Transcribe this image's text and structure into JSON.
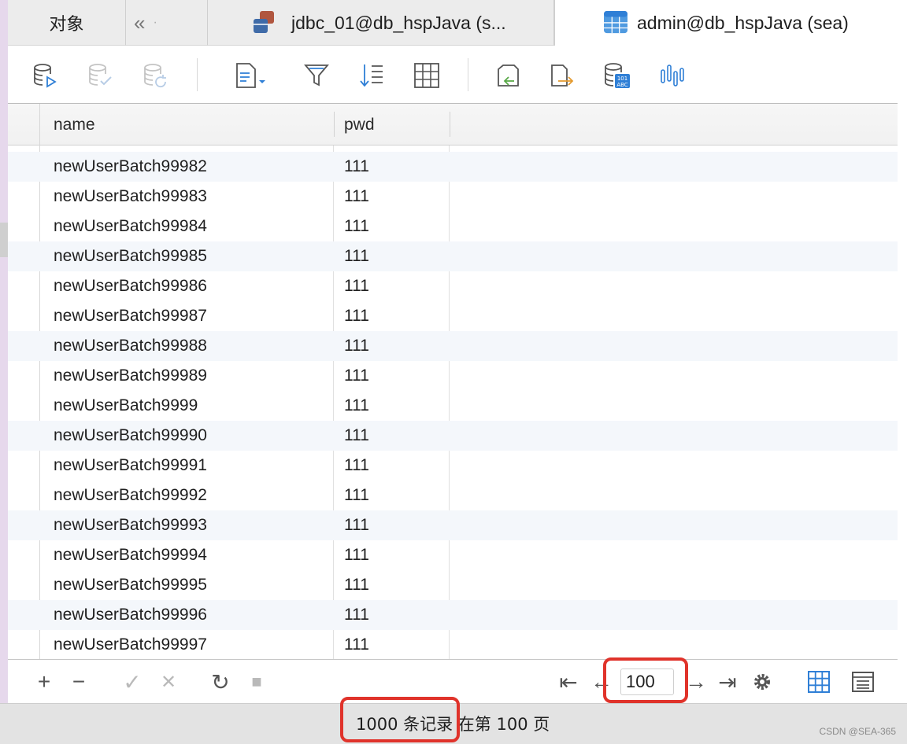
{
  "tabs": {
    "objects_label": "对象",
    "nav_label": "«",
    "nav_dot": "·",
    "jdbc_label": "jdbc_01@db_hspJava (s...",
    "admin_label": "admin@db_hspJava (sea)"
  },
  "toolbar": {
    "icons": [
      "database-run-icon",
      "database-check-icon",
      "database-refresh-icon",
      "document-menu-icon",
      "filter-icon",
      "sort-icon",
      "grid-icon",
      "import-icon",
      "export-icon",
      "database-abc-icon",
      "chart-icon"
    ]
  },
  "grid": {
    "columns": [
      "name",
      "pwd"
    ],
    "rows": [
      {
        "name": "newUserBatch99982",
        "pwd": "111"
      },
      {
        "name": "newUserBatch99983",
        "pwd": "111"
      },
      {
        "name": "newUserBatch99984",
        "pwd": "111"
      },
      {
        "name": "newUserBatch99985",
        "pwd": "111"
      },
      {
        "name": "newUserBatch99986",
        "pwd": "111"
      },
      {
        "name": "newUserBatch99987",
        "pwd": "111"
      },
      {
        "name": "newUserBatch99988",
        "pwd": "111"
      },
      {
        "name": "newUserBatch99989",
        "pwd": "111"
      },
      {
        "name": "newUserBatch9999",
        "pwd": "111"
      },
      {
        "name": "newUserBatch99990",
        "pwd": "111"
      },
      {
        "name": "newUserBatch99991",
        "pwd": "111"
      },
      {
        "name": "newUserBatch99992",
        "pwd": "111"
      },
      {
        "name": "newUserBatch99993",
        "pwd": "111"
      },
      {
        "name": "newUserBatch99994",
        "pwd": "111"
      },
      {
        "name": "newUserBatch99995",
        "pwd": "111"
      },
      {
        "name": "newUserBatch99996",
        "pwd": "111"
      },
      {
        "name": "newUserBatch99997",
        "pwd": "111"
      }
    ]
  },
  "actionbar": {
    "add": "+",
    "remove": "−",
    "apply": "✓",
    "discard": "✕",
    "refresh": "↻",
    "stop": "■",
    "first_page": "⇤",
    "prev_page": "←",
    "page_value": "100",
    "next_page": "→",
    "last_page": "⇥"
  },
  "status": {
    "text": "1000 条记录 在第 100 页"
  },
  "watermark": "CSDN @SEA-365",
  "colors": {
    "accent": "#2f7fd6",
    "highlight": "#e0332b",
    "alt_row": "#f4f7fb"
  }
}
